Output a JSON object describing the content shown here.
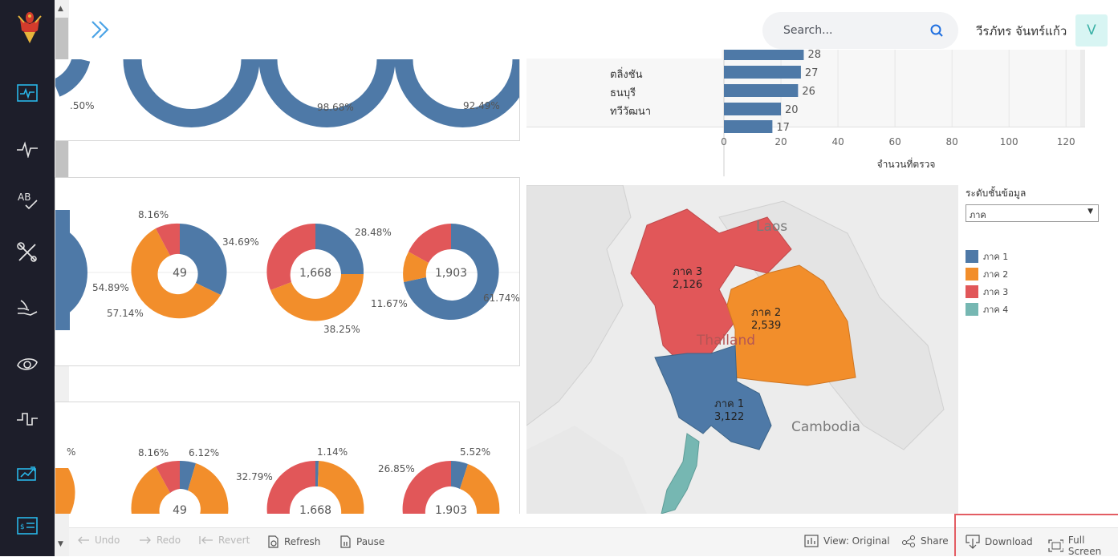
{
  "header": {
    "search_placeholder": "Search...",
    "user_name": "วีรภัทร จันทร์แก้ว",
    "avatar_letter": "V"
  },
  "colors": {
    "blue": "#4e79a7",
    "orange": "#f28e2b",
    "red": "#e15759",
    "teal": "#76b7b2",
    "sidebar": "#1d1e2a"
  },
  "sidebar": {
    "items": [
      "pulse-monitor-icon",
      "heartbeat-icon",
      "ab-check-icon",
      "tools-icon",
      "hand-icon",
      "eye-icon",
      "signal-icon",
      "growth-chart-icon",
      "receipt-icon"
    ]
  },
  "donuts": {
    "row1": [
      {
        "label_left": ".50%"
      },
      {
        "label": "98.68%"
      },
      {
        "label": "92.49%"
      }
    ],
    "row2": [
      {
        "pct_a": "54.89%"
      },
      {
        "center": "49",
        "pct_a": "8.16%",
        "pct_b": "34.69%",
        "pct_c": "57.14%"
      },
      {
        "center": "1,668",
        "pct_a": "28.48%",
        "pct_b": "38.25%"
      },
      {
        "center": "1,903",
        "pct_a": "11.67%",
        "pct_b": "61.74%"
      }
    ],
    "row3": [
      {
        "pct_a": "%"
      },
      {
        "center": "49",
        "pct_a": "8.16%",
        "pct_b": "6.12%"
      },
      {
        "center": "1,668",
        "pct_a": "1.14%",
        "pct_b": "32.79%"
      },
      {
        "center": "1,903",
        "pct_a": "26.85%",
        "pct_b": "5.52%"
      }
    ]
  },
  "chart_data": {
    "type": "bar",
    "orientation": "horizontal",
    "categories": [
      "ตลิ่งชัน",
      "ธนบุรี",
      "ทวีวัฒนา"
    ],
    "values": [
      28,
      27,
      26,
      20,
      17
    ],
    "value_labels": [
      "28",
      "27",
      "26",
      "20",
      "17"
    ],
    "xlabel": "จำนวนที่ตรวจ",
    "xticks": [
      "0",
      "20",
      "40",
      "60",
      "80",
      "100",
      "120"
    ],
    "xlim": [
      0,
      125
    ],
    "grid": true
  },
  "map": {
    "countries": [
      "Laos",
      "Thailand",
      "Cambodia"
    ],
    "regions": [
      {
        "name": "ภาค 3",
        "value": "2,126"
      },
      {
        "name": "ภาค 2",
        "value": "2,539"
      },
      {
        "name": "ภาค 1",
        "value": "3,122"
      }
    ]
  },
  "legend": {
    "title": "ระดับชั้นข้อมูล",
    "selected": "ภาค",
    "items": [
      "ภาค 1",
      "ภาค 2",
      "ภาค 3",
      "ภาค 4"
    ]
  },
  "toolbar": {
    "undo": "Undo",
    "redo": "Redo",
    "revert": "Revert",
    "refresh": "Refresh",
    "pause": "Pause",
    "view": "View: Original",
    "share": "Share",
    "download": "Download",
    "fullscreen": "Full Screen"
  }
}
